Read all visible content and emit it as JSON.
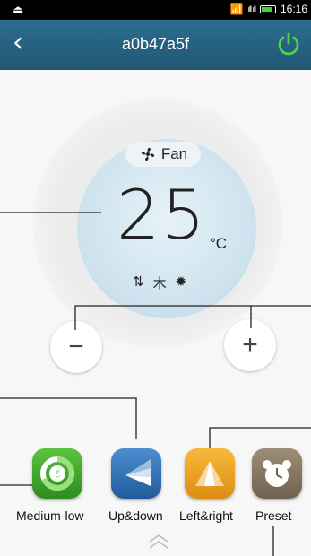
{
  "status_bar": {
    "time": "16:16",
    "icons": [
      "notification-icon",
      "wifi-icon",
      "signal-icon",
      "battery-icon"
    ]
  },
  "header": {
    "title": "a0b47a5f",
    "back_icon": "chevron-left-icon",
    "power_icon": "power-icon",
    "power_color": "#49d14a"
  },
  "thermostat": {
    "mode_label": "Fan",
    "mode_icon": "fan-icon",
    "temperature": "25",
    "unit": "°C",
    "status_icons": [
      "swing-updown-icon",
      "tree-icon",
      "light-icon"
    ]
  },
  "controls": {
    "minus": "−",
    "plus": "+"
  },
  "functions": [
    {
      "label": "Medium-low",
      "icon": "fan-speed-icon",
      "color": "#3ea52a"
    },
    {
      "label": "Up&down",
      "icon": "swing-updown-icon",
      "color": "#2f6fb2"
    },
    {
      "label": "Left&right",
      "icon": "swing-leftright-icon",
      "color": "#eba324"
    },
    {
      "label": "Preset",
      "icon": "alarm-clock-icon",
      "color": "#85766a"
    }
  ]
}
